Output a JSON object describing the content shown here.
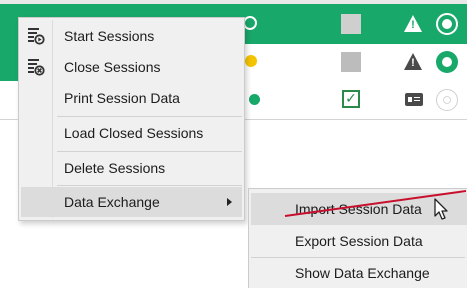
{
  "context_menu": {
    "items": [
      {
        "label": "Start Sessions",
        "icon": "start-session-icon"
      },
      {
        "label": "Close Sessions",
        "icon": "close-session-icon"
      },
      {
        "label": "Print Session Data"
      },
      {
        "label": "Load Closed Sessions"
      },
      {
        "label": "Delete Sessions"
      },
      {
        "label": "Data Exchange",
        "has_submenu": true,
        "highlighted": true
      }
    ]
  },
  "submenu": {
    "items": [
      {
        "label": "Import Session Data",
        "highlighted": true
      },
      {
        "label": "Export Session Data"
      },
      {
        "label": "Show Data Exchange"
      }
    ]
  },
  "colors": {
    "status_green": "#18a86a",
    "status_yellow": "#f5c400",
    "annotation_red": "#c8102e",
    "menu_background": "#f0f0f0",
    "menu_highlight": "#dcdcdc"
  },
  "grid_icons": [
    "status-ring-icon",
    "status-dot-icon",
    "state-square-icon",
    "warning-icon",
    "checkbox-checked-icon",
    "id-card-icon",
    "status-circle-icon"
  ]
}
